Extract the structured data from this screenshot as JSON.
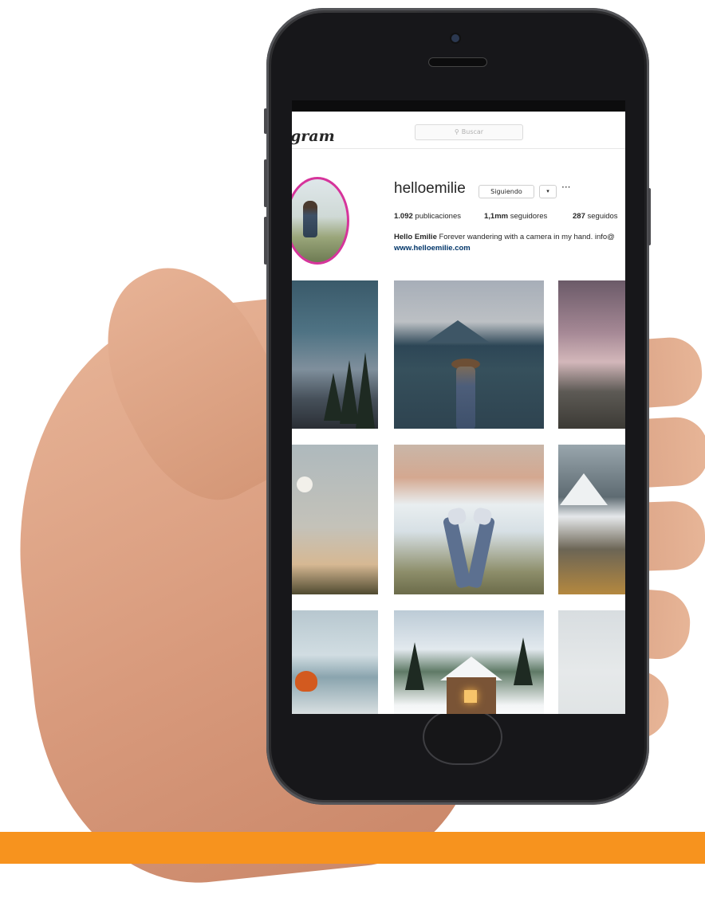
{
  "app": {
    "logo_text": "gram",
    "search_placeholder": "Buscar"
  },
  "profile": {
    "username": "helloemilie",
    "follow_label": "Siguiendo",
    "dropdown_label": "▾",
    "more_label": "···",
    "stats": {
      "posts_value": "1.092",
      "posts_label": "publicaciones",
      "followers_value": "1,1mm",
      "followers_label": "seguidores",
      "following_value": "287",
      "following_label": "seguidos"
    },
    "bio_name": "Hello Emilie",
    "bio_text": "Forever wandering with a camera in my hand. info@",
    "website": "www.helloemilie.com"
  },
  "icons": {
    "search": "search-icon",
    "camera": "front-camera-icon"
  },
  "colors": {
    "accent_bar": "#f7931e",
    "story_ring": "#d6349b",
    "link": "#003569"
  }
}
